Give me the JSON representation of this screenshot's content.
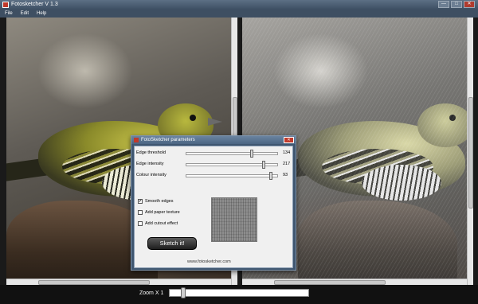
{
  "window": {
    "title": "Fotosketcher V 1.3",
    "buttons": {
      "minimize": "—",
      "maximize": "□",
      "close": "✕"
    }
  },
  "menu": {
    "items": [
      "File",
      "Edit",
      "Help"
    ]
  },
  "zoom": {
    "label": "Zoom X 1",
    "level": 0.1
  },
  "dialog": {
    "title": "FotoSketcher parameters",
    "close": "✕",
    "params": [
      {
        "label": "Edge threshold",
        "value": "134",
        "fraction": 0.72
      },
      {
        "label": "Edge intensity",
        "value": "217",
        "fraction": 0.85
      },
      {
        "label": "Colour intensity",
        "value": "93",
        "fraction": 0.93
      }
    ],
    "options": [
      {
        "label": "Smooth edges",
        "checked": true,
        "mark": "✔"
      },
      {
        "label": "Add paper texture",
        "checked": false,
        "mark": ""
      },
      {
        "label": "Add cutout effect",
        "checked": false,
        "mark": ""
      }
    ],
    "button_label": "Sketch it!",
    "website": "www.fotosketcher.com"
  },
  "colors": {
    "titlebar": "#4a5d72",
    "dialog_frame": "#3f5670",
    "background": "#1a1a1a"
  }
}
